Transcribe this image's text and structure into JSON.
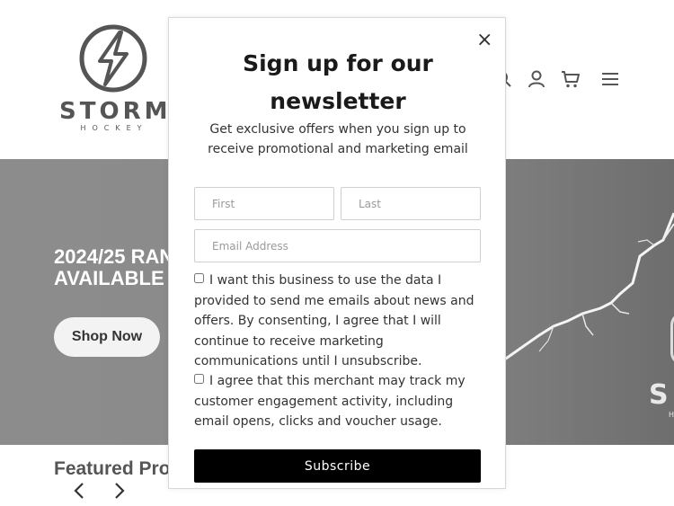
{
  "brand": {
    "name": "STORM",
    "tagline": "HOCKEY"
  },
  "header": {
    "icons": [
      "search-icon",
      "account-icon",
      "cart-icon",
      "menu-icon"
    ]
  },
  "hero": {
    "title": "2024/25 RAN\nAVAILABLE N",
    "cta_label": "Shop Now",
    "logo_letter": "S",
    "logo_sub": "H"
  },
  "featured": {
    "title": "Featured Pro",
    "prev_icon": "chevron-left-icon",
    "next_icon": "chevron-right-icon"
  },
  "modal": {
    "close_label": "×",
    "title": "Sign up for our newsletter",
    "subtitle": "Get exclusive offers when you sign up to receive promotional and marketing email",
    "first_placeholder": "First",
    "last_placeholder": "Last",
    "email_placeholder": "Email Address",
    "consent_data": "I want this business to use the data I provided to send me emails about news and offers. By consenting, I agree that I will continue to receive marketing communications until I unsubscribe.",
    "consent_tracking": "I agree that this merchant may track my customer engagement activity, including email opens, clicks and voucher usage.",
    "subscribe_label": "Subscribe"
  },
  "colors": {
    "hero_gray": "#8a8a8a",
    "subscribe_bg": "#000000",
    "brand_gray": "#555555"
  }
}
